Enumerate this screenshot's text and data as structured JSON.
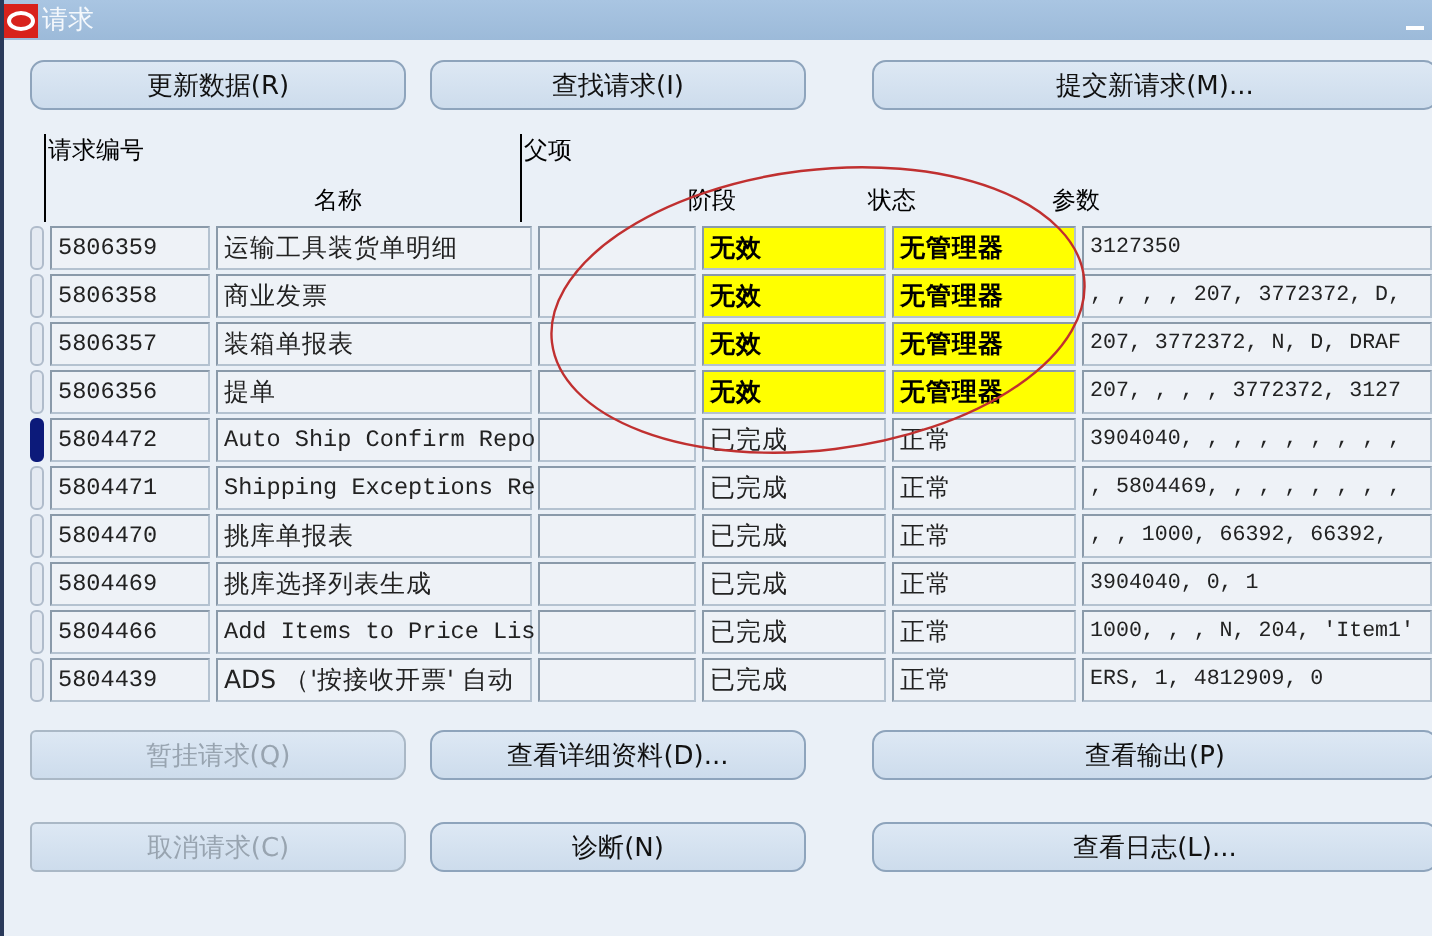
{
  "window": {
    "title": "请求"
  },
  "buttons_top": [
    {
      "label": "更新数据(R)",
      "disabled": false
    },
    {
      "label": "查找请求(I)",
      "disabled": false
    },
    {
      "label": "提交新请求(M)...",
      "disabled": false
    }
  ],
  "table": {
    "headers": {
      "request_id": "请求编号",
      "parent": "父项",
      "name": "名称",
      "phase": "阶段",
      "status": "状态",
      "parameters": "参数"
    },
    "rows": [
      {
        "request_id": "5806359",
        "name": "运输工具装货单明细",
        "parent": "",
        "phase": "无效",
        "status": "无管理器",
        "parameters": "3127350",
        "flagged": true,
        "selected": false
      },
      {
        "request_id": "5806358",
        "name": "商业发票",
        "parent": "",
        "phase": "无效",
        "status": "无管理器",
        "parameters": ", , , , 207, 3772372, D,",
        "flagged": true,
        "selected": false
      },
      {
        "request_id": "5806357",
        "name": "装箱单报表",
        "parent": "",
        "phase": "无效",
        "status": "无管理器",
        "parameters": "207, 3772372, N, D, DRAF",
        "flagged": true,
        "selected": false
      },
      {
        "request_id": "5806356",
        "name": "提单",
        "parent": "",
        "phase": "无效",
        "status": "无管理器",
        "parameters": "207, , , , 3772372, 3127",
        "flagged": true,
        "selected": false
      },
      {
        "request_id": "5804472",
        "name": "Auto Ship Confirm Repo",
        "parent": "",
        "phase": "已完成",
        "status": "正常",
        "parameters": "3904040, , , , , , , , ,",
        "flagged": false,
        "selected": true
      },
      {
        "request_id": "5804471",
        "name": "Shipping Exceptions Re",
        "parent": "",
        "phase": "已完成",
        "status": "正常",
        "parameters": ", 5804469, , , , , , , ,",
        "flagged": false,
        "selected": false
      },
      {
        "request_id": "5804470",
        "name": "挑库单报表",
        "parent": "",
        "phase": "已完成",
        "status": "正常",
        "parameters": ", , 1000, 66392, 66392,",
        "flagged": false,
        "selected": false
      },
      {
        "request_id": "5804469",
        "name": "挑库选择列表生成",
        "parent": "",
        "phase": "已完成",
        "status": "正常",
        "parameters": "3904040, 0, 1",
        "flagged": false,
        "selected": false
      },
      {
        "request_id": "5804466",
        "name": "Add Items to Price Lis",
        "parent": "",
        "phase": "已完成",
        "status": "正常",
        "parameters": "1000, , , N, 204, 'Item1'",
        "flagged": false,
        "selected": false
      },
      {
        "request_id": "5804439",
        "name": "ADS （'按接收开票' 自动",
        "parent": "",
        "phase": "已完成",
        "status": "正常",
        "parameters": "ERS, 1, 4812909, 0",
        "flagged": false,
        "selected": false
      }
    ]
  },
  "buttons_bottom": [
    {
      "label": "暂挂请求(Q)",
      "disabled": true
    },
    {
      "label": "查看详细资料(D)...",
      "disabled": false
    },
    {
      "label": "查看输出(P)",
      "disabled": false
    },
    {
      "label": "取消请求(C)",
      "disabled": true
    },
    {
      "label": "诊断(N)",
      "disabled": false
    },
    {
      "label": "查看日志(L)...",
      "disabled": false
    }
  ],
  "annotations": [
    {
      "kind": "ellipse",
      "color": "#c03030"
    }
  ]
}
